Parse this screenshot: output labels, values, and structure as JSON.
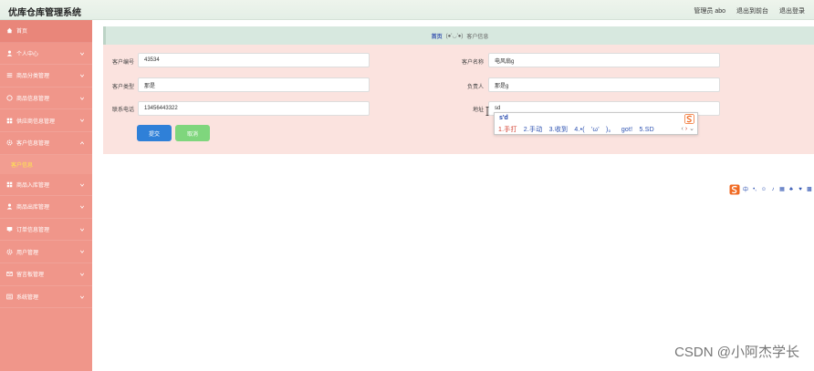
{
  "app": {
    "title": "优库仓库管理系统"
  },
  "header": {
    "links": [
      "管理员 abo",
      "退出到前台",
      "退出登录"
    ]
  },
  "sidebar": {
    "items": [
      {
        "label": "首页",
        "icon": "home-icon"
      },
      {
        "label": "个人中心",
        "icon": "user-icon"
      },
      {
        "label": "商品分类管理",
        "icon": "list-icon"
      },
      {
        "label": "商品信息管理",
        "icon": "box-icon"
      },
      {
        "label": "供应商信息管理",
        "icon": "grid-icon"
      },
      {
        "label": "客户信息管理",
        "icon": "gear-icon"
      },
      {
        "label": "商品入库管理",
        "icon": "grid-icon"
      },
      {
        "label": "商品出库管理",
        "icon": "user-icon"
      },
      {
        "label": "订单信息管理",
        "icon": "monitor-icon"
      },
      {
        "label": "用户管理",
        "icon": "gear-icon"
      },
      {
        "label": "留言板管理",
        "icon": "message-icon"
      },
      {
        "label": "系统管理",
        "icon": "settings-icon"
      }
    ],
    "active_sub": "客户信息"
  },
  "breadcrumb": {
    "home": "首页",
    "emoticon": "(●'◡'●)",
    "current": "客户信息"
  },
  "form": {
    "fields": [
      {
        "label": "客户编号",
        "value": "43534"
      },
      {
        "label": "客户名称",
        "value": "电风扇g"
      },
      {
        "label": "客户类型",
        "value": "那是"
      },
      {
        "label": "负责人",
        "value": "那是g"
      },
      {
        "label": "联系电话",
        "value": "13456443322"
      },
      {
        "label": "地址",
        "value": "sd"
      }
    ],
    "submit_label": "提交",
    "cancel_label": "取消"
  },
  "ime": {
    "input": "s'd",
    "candidates": [
      "1.手打",
      "2.手动",
      "3.收到",
      "4.•(　'ω'　)。",
      "got!",
      "5.SD"
    ],
    "toolbar": [
      "中",
      "•,",
      "☺",
      "♪",
      "▦",
      "♣",
      "♥",
      "▩"
    ]
  },
  "watermark": "CSDN @小阿杰学长",
  "colors": {
    "sidebar": "#f0968a",
    "submit": "#2f80d8",
    "cancel": "#7fd67d",
    "panel": "#fbe3df",
    "active_sub": "#ffe84d"
  }
}
